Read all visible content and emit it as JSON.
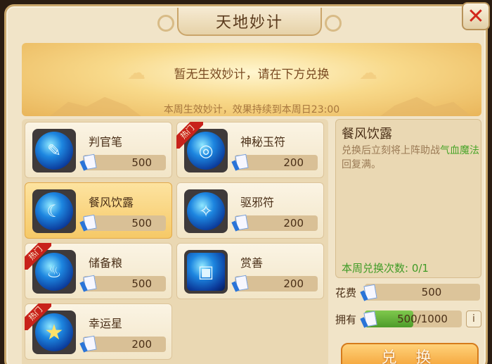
{
  "window": {
    "title": "天地妙计",
    "close_icon": "close-icon"
  },
  "banner": {
    "main": "暂无生效妙计，请在下方兑换",
    "sub": "本周生效妙计，效果持续到本周日23:00"
  },
  "hot_label": "热门",
  "items": [
    {
      "name": "判官笔",
      "price": "500",
      "hot": false,
      "selected": false,
      "icon": "brush-orb-icon"
    },
    {
      "name": "神秘玉符",
      "price": "200",
      "hot": true,
      "selected": false,
      "icon": "jade-talisman-icon"
    },
    {
      "name": "餐风饮露",
      "price": "500",
      "hot": false,
      "selected": true,
      "icon": "dew-orb-icon"
    },
    {
      "name": "驱邪符",
      "price": "200",
      "hot": false,
      "selected": false,
      "icon": "exorcism-charm-icon"
    },
    {
      "name": "储备粮",
      "price": "500",
      "hot": true,
      "selected": false,
      "icon": "grain-sack-icon"
    },
    {
      "name": "赏善",
      "price": "200",
      "hot": false,
      "selected": false,
      "icon": "gift-box-icon"
    },
    {
      "name": "幸运星",
      "price": "200",
      "hot": true,
      "selected": false,
      "icon": "lucky-star-icon"
    }
  ],
  "detail": {
    "title": "餐风饮露",
    "desc_before": "兑换后立刻将上阵助战",
    "desc_hl": "气血魔法",
    "desc_after": "回复满。",
    "weekly_count": "本周兑换次数: 0/1"
  },
  "cost": {
    "label": "花费",
    "value": "500"
  },
  "own": {
    "label": "拥有",
    "value": "500/1000",
    "progress": 0.5,
    "info": "i"
  },
  "exchange_button": "兑 换"
}
